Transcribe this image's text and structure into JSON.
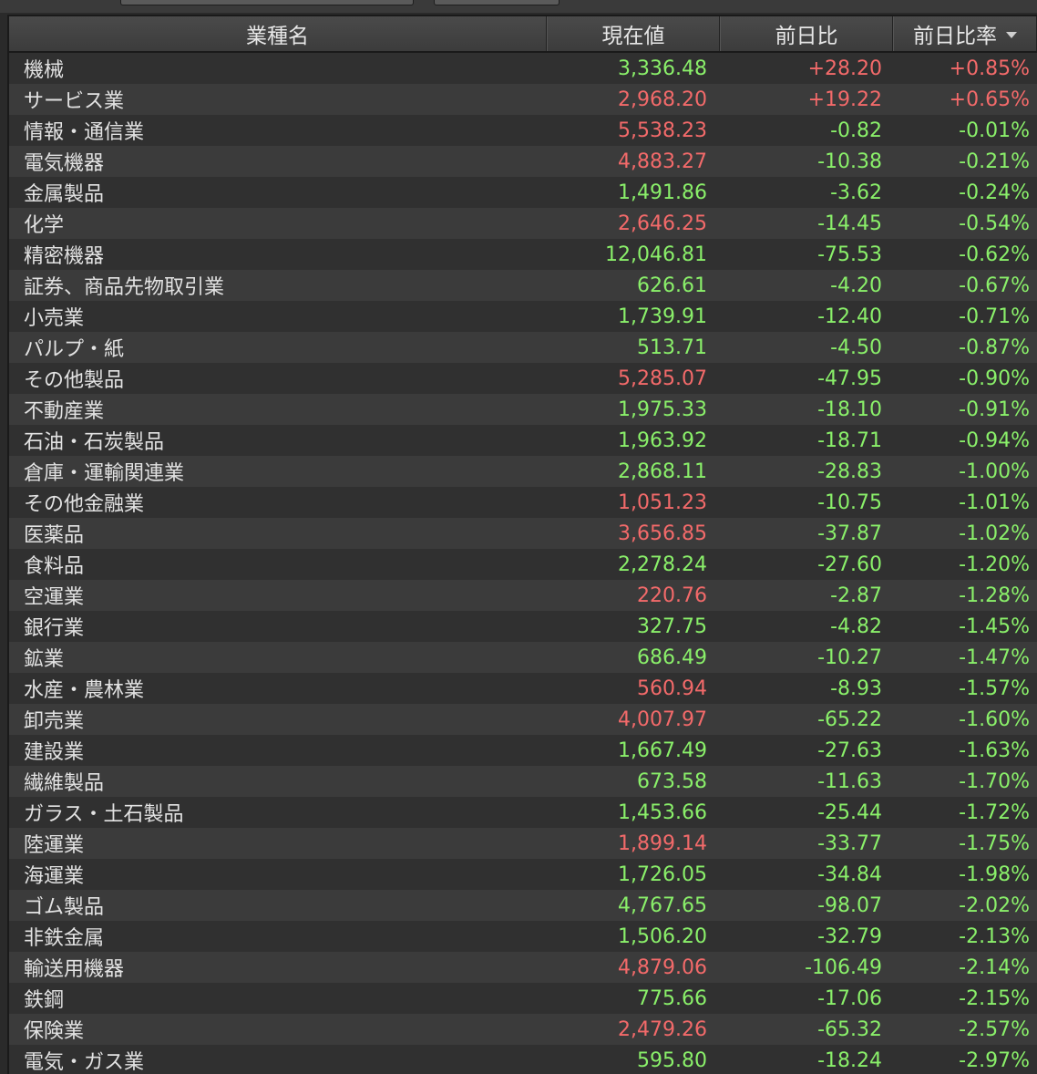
{
  "colors": {
    "positive": "#f36a6a",
    "negative": "#8af06a",
    "background": "#2a2a2a",
    "header": "#444444",
    "text": "#e2e2e2"
  },
  "table": {
    "headers": {
      "name": "業種名",
      "price": "現在値",
      "change": "前日比",
      "change_pct": "前日比率"
    },
    "sort_icon": "sort-descending-icon",
    "rows": [
      {
        "name": "機械",
        "price": "3,336.48",
        "price_color": "down",
        "change": "+28.20",
        "change_color": "up",
        "change_pct": "+0.85%",
        "pct_color": "up"
      },
      {
        "name": "サービス業",
        "price": "2,968.20",
        "price_color": "up",
        "change": "+19.22",
        "change_color": "up",
        "change_pct": "+0.65%",
        "pct_color": "up"
      },
      {
        "name": "情報・通信業",
        "price": "5,538.23",
        "price_color": "up",
        "change": "-0.82",
        "change_color": "down",
        "change_pct": "-0.01%",
        "pct_color": "down"
      },
      {
        "name": "電気機器",
        "price": "4,883.27",
        "price_color": "up",
        "change": "-10.38",
        "change_color": "down",
        "change_pct": "-0.21%",
        "pct_color": "down"
      },
      {
        "name": "金属製品",
        "price": "1,491.86",
        "price_color": "down",
        "change": "-3.62",
        "change_color": "down",
        "change_pct": "-0.24%",
        "pct_color": "down"
      },
      {
        "name": "化学",
        "price": "2,646.25",
        "price_color": "up",
        "change": "-14.45",
        "change_color": "down",
        "change_pct": "-0.54%",
        "pct_color": "down"
      },
      {
        "name": "精密機器",
        "price": "12,046.81",
        "price_color": "down",
        "change": "-75.53",
        "change_color": "down",
        "change_pct": "-0.62%",
        "pct_color": "down"
      },
      {
        "name": "証券、商品先物取引業",
        "price": "626.61",
        "price_color": "down",
        "change": "-4.20",
        "change_color": "down",
        "change_pct": "-0.67%",
        "pct_color": "down"
      },
      {
        "name": "小売業",
        "price": "1,739.91",
        "price_color": "down",
        "change": "-12.40",
        "change_color": "down",
        "change_pct": "-0.71%",
        "pct_color": "down"
      },
      {
        "name": "パルプ・紙",
        "price": "513.71",
        "price_color": "down",
        "change": "-4.50",
        "change_color": "down",
        "change_pct": "-0.87%",
        "pct_color": "down"
      },
      {
        "name": "その他製品",
        "price": "5,285.07",
        "price_color": "up",
        "change": "-47.95",
        "change_color": "down",
        "change_pct": "-0.90%",
        "pct_color": "down"
      },
      {
        "name": "不動産業",
        "price": "1,975.33",
        "price_color": "down",
        "change": "-18.10",
        "change_color": "down",
        "change_pct": "-0.91%",
        "pct_color": "down"
      },
      {
        "name": "石油・石炭製品",
        "price": "1,963.92",
        "price_color": "down",
        "change": "-18.71",
        "change_color": "down",
        "change_pct": "-0.94%",
        "pct_color": "down"
      },
      {
        "name": "倉庫・運輸関連業",
        "price": "2,868.11",
        "price_color": "down",
        "change": "-28.83",
        "change_color": "down",
        "change_pct": "-1.00%",
        "pct_color": "down"
      },
      {
        "name": "その他金融業",
        "price": "1,051.23",
        "price_color": "up",
        "change": "-10.75",
        "change_color": "down",
        "change_pct": "-1.01%",
        "pct_color": "down"
      },
      {
        "name": "医薬品",
        "price": "3,656.85",
        "price_color": "up",
        "change": "-37.87",
        "change_color": "down",
        "change_pct": "-1.02%",
        "pct_color": "down"
      },
      {
        "name": "食料品",
        "price": "2,278.24",
        "price_color": "down",
        "change": "-27.60",
        "change_color": "down",
        "change_pct": "-1.20%",
        "pct_color": "down"
      },
      {
        "name": "空運業",
        "price": "220.76",
        "price_color": "up",
        "change": "-2.87",
        "change_color": "down",
        "change_pct": "-1.28%",
        "pct_color": "down"
      },
      {
        "name": "銀行業",
        "price": "327.75",
        "price_color": "down",
        "change": "-4.82",
        "change_color": "down",
        "change_pct": "-1.45%",
        "pct_color": "down"
      },
      {
        "name": "鉱業",
        "price": "686.49",
        "price_color": "down",
        "change": "-10.27",
        "change_color": "down",
        "change_pct": "-1.47%",
        "pct_color": "down"
      },
      {
        "name": "水産・農林業",
        "price": "560.94",
        "price_color": "up",
        "change": "-8.93",
        "change_color": "down",
        "change_pct": "-1.57%",
        "pct_color": "down"
      },
      {
        "name": "卸売業",
        "price": "4,007.97",
        "price_color": "up",
        "change": "-65.22",
        "change_color": "down",
        "change_pct": "-1.60%",
        "pct_color": "down"
      },
      {
        "name": "建設業",
        "price": "1,667.49",
        "price_color": "down",
        "change": "-27.63",
        "change_color": "down",
        "change_pct": "-1.63%",
        "pct_color": "down"
      },
      {
        "name": "繊維製品",
        "price": "673.58",
        "price_color": "down",
        "change": "-11.63",
        "change_color": "down",
        "change_pct": "-1.70%",
        "pct_color": "down"
      },
      {
        "name": "ガラス・土石製品",
        "price": "1,453.66",
        "price_color": "down",
        "change": "-25.44",
        "change_color": "down",
        "change_pct": "-1.72%",
        "pct_color": "down"
      },
      {
        "name": "陸運業",
        "price": "1,899.14",
        "price_color": "up",
        "change": "-33.77",
        "change_color": "down",
        "change_pct": "-1.75%",
        "pct_color": "down"
      },
      {
        "name": "海運業",
        "price": "1,726.05",
        "price_color": "down",
        "change": "-34.84",
        "change_color": "down",
        "change_pct": "-1.98%",
        "pct_color": "down"
      },
      {
        "name": "ゴム製品",
        "price": "4,767.65",
        "price_color": "down",
        "change": "-98.07",
        "change_color": "down",
        "change_pct": "-2.02%",
        "pct_color": "down"
      },
      {
        "name": "非鉄金属",
        "price": "1,506.20",
        "price_color": "down",
        "change": "-32.79",
        "change_color": "down",
        "change_pct": "-2.13%",
        "pct_color": "down"
      },
      {
        "name": "輸送用機器",
        "price": "4,879.06",
        "price_color": "up",
        "change": "-106.49",
        "change_color": "down",
        "change_pct": "-2.14%",
        "pct_color": "down"
      },
      {
        "name": "鉄鋼",
        "price": "775.66",
        "price_color": "down",
        "change": "-17.06",
        "change_color": "down",
        "change_pct": "-2.15%",
        "pct_color": "down"
      },
      {
        "name": "保険業",
        "price": "2,479.26",
        "price_color": "up",
        "change": "-65.32",
        "change_color": "down",
        "change_pct": "-2.57%",
        "pct_color": "down"
      },
      {
        "name": "電気・ガス業",
        "price": "595.80",
        "price_color": "down",
        "change": "-18.24",
        "change_color": "down",
        "change_pct": "-2.97%",
        "pct_color": "down"
      }
    ]
  }
}
